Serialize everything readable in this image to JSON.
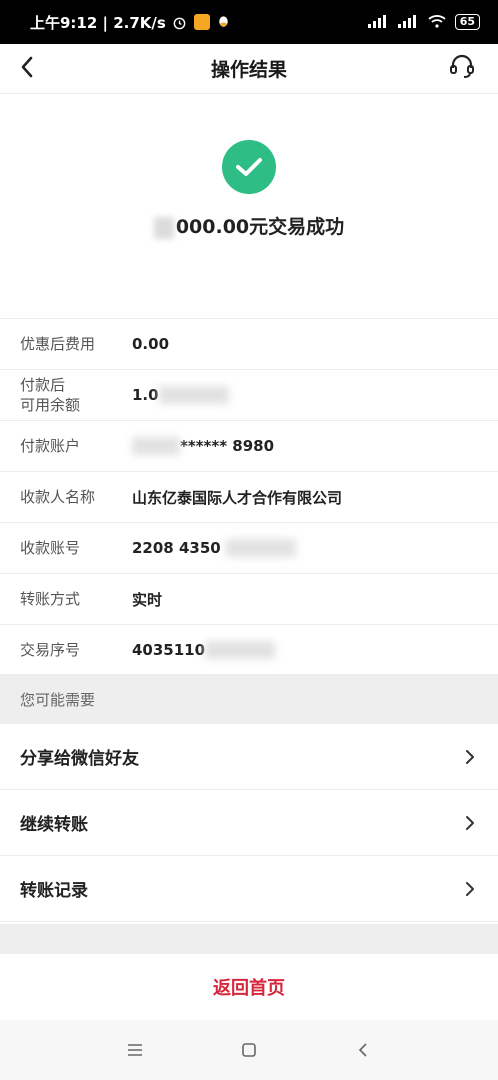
{
  "status_bar": {
    "time": "上午9:12 | 2.7K/s",
    "battery": "65"
  },
  "header": {
    "title": "操作结果",
    "back_icon": "chevron-left-icon",
    "service_icon": "headset-icon"
  },
  "result": {
    "amount_text": "000.00元交易成功",
    "icon": "check-circle-icon",
    "icon_color": "#2dbd85"
  },
  "details": [
    {
      "label": "优惠后费用",
      "value": "0.00"
    },
    {
      "label": "付款后\n可用余额",
      "value": "1.0"
    },
    {
      "label": "付款账户",
      "value": "****** 8980"
    },
    {
      "label": "收款人名称",
      "value": "山东亿泰国际人才合作有限公司"
    },
    {
      "label": "收款账号",
      "value": "2208 4350"
    },
    {
      "label": "转账方式",
      "value": "实时"
    },
    {
      "label": "交易序号",
      "value": "4035110"
    }
  ],
  "section": {
    "title": "您可能需要"
  },
  "menu": [
    {
      "label": "分享给微信好友"
    },
    {
      "label": "继续转账"
    },
    {
      "label": "转账记录"
    }
  ],
  "home_button": {
    "label": "返回首页",
    "color": "#d6263c"
  }
}
